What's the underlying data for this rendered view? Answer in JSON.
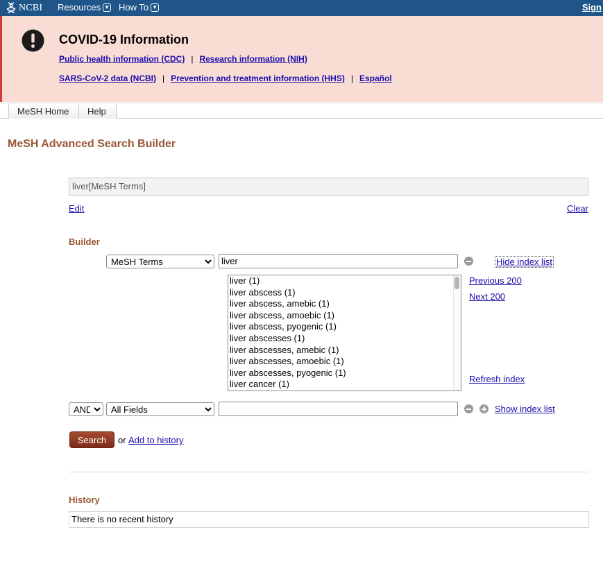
{
  "topbar": {
    "logo_text": "NCBI",
    "resources_label": "Resources",
    "howto_label": "How To",
    "signin_label": "Sign"
  },
  "covid": {
    "title": "COVID-19 Information",
    "links_row1": [
      "Public health information (CDC)",
      "Research information (NIH)"
    ],
    "links_row2": [
      "SARS-CoV-2 data (NCBI)",
      "Prevention and treatment information (HHS)",
      "Español"
    ],
    "separator": "|"
  },
  "tabs": [
    "MeSH Home",
    "Help"
  ],
  "page_title": "MeSH Advanced Search Builder",
  "query": {
    "value": "liver[MeSH Terms]",
    "edit_label": "Edit",
    "clear_label": "Clear"
  },
  "builder": {
    "label": "Builder",
    "row1": {
      "field": "MeSH Terms",
      "term": "liver",
      "toggle_label": "Hide index list"
    },
    "index_items": [
      "liver (1)",
      "liver abscess (1)",
      "liver abscess, amebic (1)",
      "liver abscess, amoebic (1)",
      "liver abscess, pyogenic (1)",
      "liver abscesses (1)",
      "liver abscesses, amebic (1)",
      "liver abscesses, amoebic (1)",
      "liver abscesses, pyogenic (1)",
      "liver cancer (1)"
    ],
    "previous_label": "Previous 200",
    "next_label": "Next 200",
    "refresh_label": "Refresh index",
    "row2": {
      "operator": "AND",
      "field": "All Fields",
      "term": "",
      "toggle_label": "Show index list"
    }
  },
  "actions": {
    "search_label": "Search",
    "or_text": "or",
    "add_history_label": "Add to history"
  },
  "history": {
    "label": "History",
    "empty_text": "There is no recent history"
  },
  "colors": {
    "topbar": "#20558a",
    "banner_bg": "#f9dcd4",
    "banner_border": "#d83933",
    "heading": "#985735",
    "link": "#1a0dab",
    "search_button": "#8e3822"
  }
}
